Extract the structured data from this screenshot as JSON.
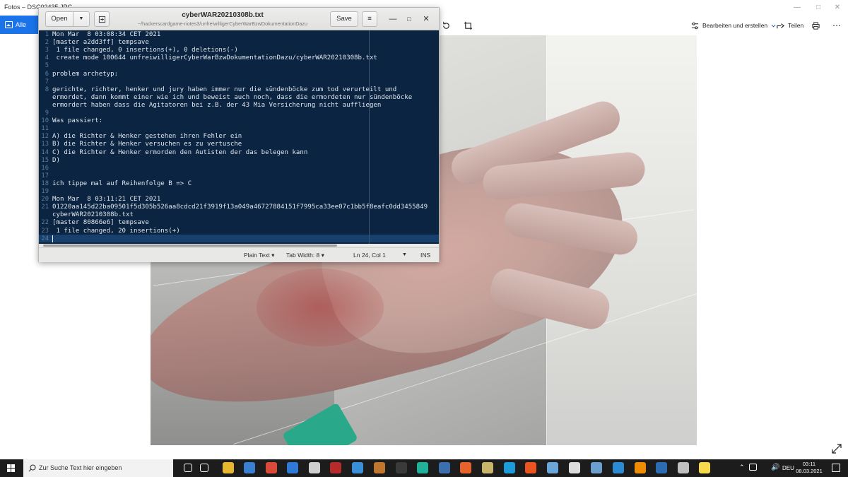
{
  "photos": {
    "window_title": "Fotos – DSC02435.JPG",
    "alle_fotos_label": "Alle Fotos",
    "edit_label": "Bearbeiten und erstellen",
    "share_label": "Teilen"
  },
  "gedit": {
    "title": "cyberWAR20210308b.txt",
    "path": "~/hackerscardgame-notes3/unfreiwilligerCyberWarBzwDokumentationDazu",
    "open_label": "Open",
    "save_label": "Save",
    "lines": [
      {
        "n": "1",
        "text": "Mon Mar  8 03:08:34 CET 2021"
      },
      {
        "n": "2",
        "text": "[master a2dd3ff] tempsave"
      },
      {
        "n": "3",
        "text": " 1 file changed, 0 insertions(+), 0 deletions(-)"
      },
      {
        "n": "4",
        "text": " create mode 100644 unfreiwilligerCyberWarBzwDokumentationDazu/cyberWAR20210308b.txt"
      },
      {
        "n": "5",
        "text": ""
      },
      {
        "n": "6",
        "text": "problem archetyp:"
      },
      {
        "n": "7",
        "text": ""
      },
      {
        "n": "8",
        "text": "gerichte, richter, henker und jury haben immer nur die sündenböcke zum tod verurteilt und"
      },
      {
        "n": "",
        "text": "ermordet, dann kommt einer wie ich und beweist auch noch, dass die ermordeten nur sündenböcke"
      },
      {
        "n": "",
        "text": "ermordert haben dass die Agitatoren bei z.B. der 43 Mia Versicherung nicht auffliegen"
      },
      {
        "n": "9",
        "text": ""
      },
      {
        "n": "10",
        "text": "Was passiert:"
      },
      {
        "n": "11",
        "text": ""
      },
      {
        "n": "12",
        "text": "A) die Richter & Henker gestehen ihren Fehler ein"
      },
      {
        "n": "13",
        "text": "B) die Richter & Henker versuchen es zu vertusche"
      },
      {
        "n": "14",
        "text": "C) die Richter & Henker ermorden den Autisten der das belegen kann"
      },
      {
        "n": "15",
        "text": "D)"
      },
      {
        "n": "16",
        "text": ""
      },
      {
        "n": "17",
        "text": ""
      },
      {
        "n": "18",
        "text": "ich tippe mal auf Reihenfolge B => C"
      },
      {
        "n": "19",
        "text": ""
      },
      {
        "n": "20",
        "text": "Mon Mar  8 03:11:21 CET 2021"
      },
      {
        "n": "21",
        "text": "01220aa145d22ba09501f5d305b526aa8cdcd21f3919f13a049a46727884151f7995ca33ee07c1bb5f8eafc0dd3455849"
      },
      {
        "n": "",
        "text": "cyberWAR20210308b.txt"
      },
      {
        "n": "22",
        "text": "[master 80866e6] tempsave"
      },
      {
        "n": "23",
        "text": " 1 file changed, 20 insertions(+)"
      },
      {
        "n": "24",
        "text": ""
      }
    ],
    "status": {
      "language": "Plain Text",
      "tab_width": "Tab Width: 8",
      "position": "Ln 24, Col 1",
      "mode": "INS"
    }
  },
  "taskbar": {
    "search_placeholder": "Zur Suche Text hier eingeben",
    "language": "DEU",
    "time": "03:11",
    "date": "08.03.2021"
  },
  "colors": {
    "editor_bg": "#0b2441",
    "taskbar_bg": "#1c1c1c",
    "photos_accent": "#1a73e8"
  }
}
